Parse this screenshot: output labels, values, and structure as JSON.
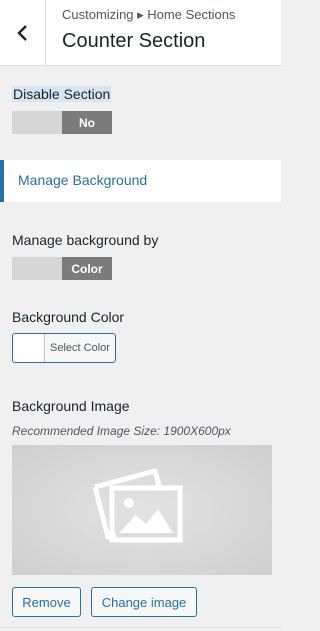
{
  "header": {
    "breadcrumb": "Customizing ▸ Home Sections",
    "title": "Counter Section",
    "back_icon": "chevron-left-icon"
  },
  "disable_section": {
    "label": "Disable Section",
    "value": "No"
  },
  "manage_background_section": {
    "label": "Manage Background",
    "accent_color": "#2271b1"
  },
  "manage_background_by": {
    "label": "Manage background by",
    "value": "Color"
  },
  "background_color": {
    "label": "Background Color",
    "button_label": "Select Color",
    "current_color": "#ffffff"
  },
  "background_image": {
    "label": "Background Image",
    "description": "Recommended Image Size: 1900X600px",
    "placeholder_icon": "images-icon",
    "remove_label": "Remove",
    "change_label": "Change image"
  }
}
